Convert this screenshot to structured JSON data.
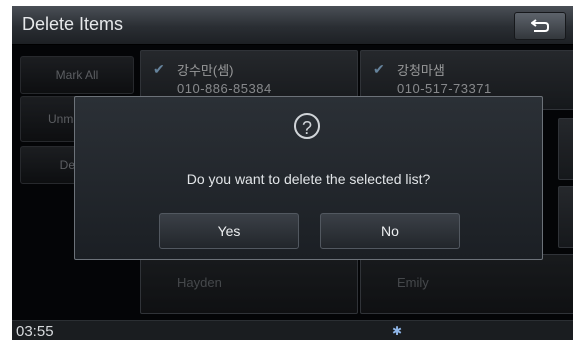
{
  "header": {
    "title": "Delete Items"
  },
  "sidebar": {
    "buttons": [
      "Mark All",
      "Unmark All",
      "Delete"
    ]
  },
  "contacts": [
    {
      "name": "강수만(셈)",
      "phone": "010-886-85384",
      "checked": true
    },
    {
      "name": "강청마샘",
      "phone": "010-517-73371",
      "checked": true
    },
    {
      "name": "Hayden",
      "phone": "",
      "checked": false
    },
    {
      "name": "Emily",
      "phone": "",
      "checked": false
    }
  ],
  "dialog": {
    "icon": "question-icon",
    "message": "Do you want to delete the selected list?",
    "yes_label": "Yes",
    "no_label": "No"
  },
  "status": {
    "time": "03:55",
    "bluetooth_icon": "bluetooth-icon"
  }
}
